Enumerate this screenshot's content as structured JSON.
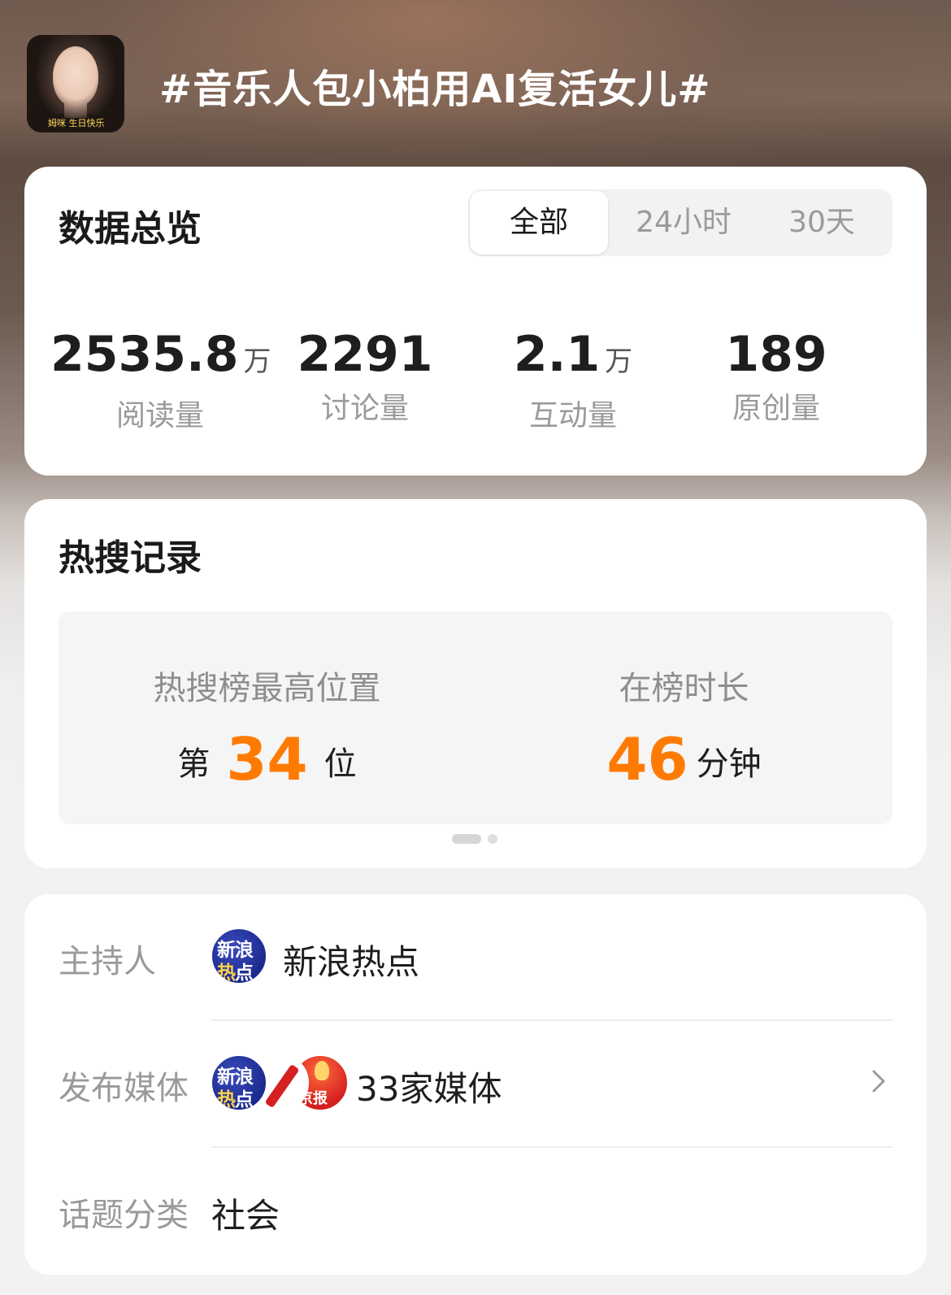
{
  "header": {
    "title": "#音乐人包小柏用AI复活女儿#",
    "avatar_caption": "姆咪 生日快乐"
  },
  "overview": {
    "title": "数据总览",
    "tabs": [
      {
        "label": "全部",
        "active": true
      },
      {
        "label": "24小时",
        "active": false
      },
      {
        "label": "30天",
        "active": false
      }
    ],
    "stats": [
      {
        "value": "2535.8",
        "unit": "万",
        "label": "阅读量"
      },
      {
        "value": "2291",
        "unit": "",
        "label": "讨论量"
      },
      {
        "value": "2.1",
        "unit": "万",
        "label": "互动量"
      },
      {
        "value": "189",
        "unit": "",
        "label": "原创量"
      }
    ]
  },
  "hot": {
    "title": "热搜记录",
    "peak": {
      "label": "热搜榜最高位置",
      "prefix": "第",
      "value": "34",
      "suffix": "位"
    },
    "duration": {
      "label": "在榜时长",
      "value": "46",
      "suffix": "分钟"
    },
    "page_count": 2,
    "page_index": 0,
    "accent_color": "#ff7a00"
  },
  "info": {
    "host": {
      "key": "主持人",
      "name": "新浪热点",
      "logo": "sina-hot-logo",
      "logo_text_1": "新浪",
      "logo_text_2a": "热",
      "logo_text_2b": "点"
    },
    "media": {
      "key": "发布媒体",
      "name": "33家媒体",
      "logos": [
        "sina-hot-logo",
        "pen-logo",
        "beijing-news-logo"
      ],
      "logo3_text": "京报"
    },
    "category": {
      "key": "话题分类",
      "value": "社会"
    }
  }
}
